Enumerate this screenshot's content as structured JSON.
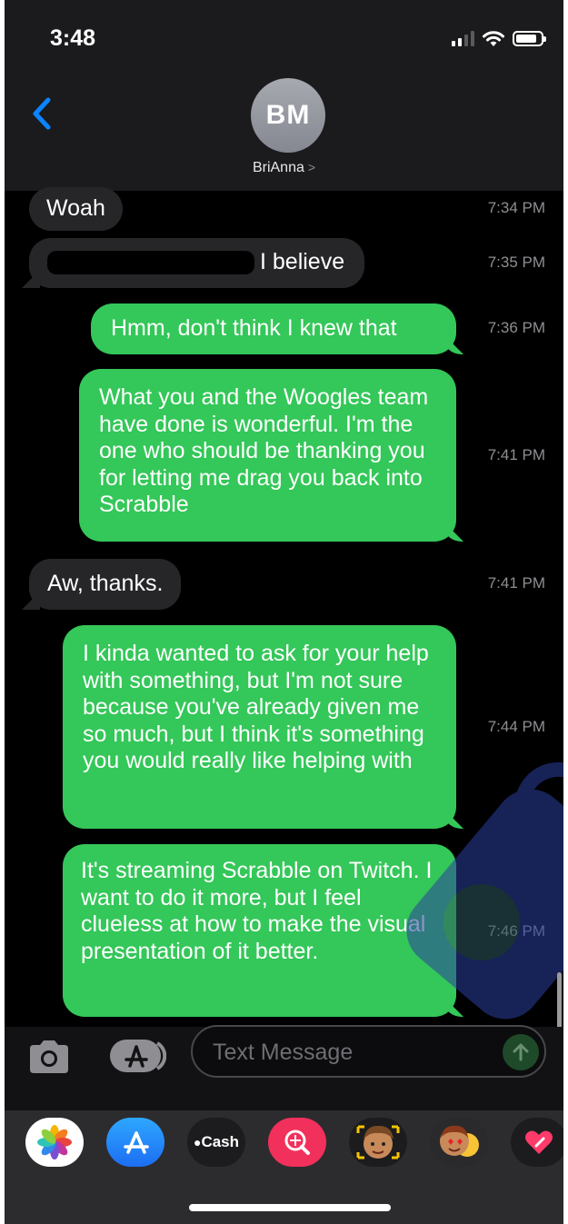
{
  "status_bar": {
    "time": "3:48"
  },
  "header": {
    "avatar_initials": "BM",
    "contact_name": "BriAnna",
    "contact_chevron": ">"
  },
  "messages": [
    {
      "direction": "incoming",
      "text": "Woah",
      "time": "7:34 PM"
    },
    {
      "direction": "incoming",
      "text": "I believe",
      "time": "7:35 PM",
      "redacted_prefix": true
    },
    {
      "direction": "outgoing",
      "text": "Hmm, don't think I knew that",
      "time": "7:36 PM"
    },
    {
      "direction": "outgoing",
      "text": "What you and the Woogles team have done is wonderful. I'm the one who should be thanking you for letting me drag you back into Scrabble",
      "time": "7:41 PM"
    },
    {
      "direction": "incoming",
      "text": "Aw, thanks.",
      "time": "7:41 PM"
    },
    {
      "direction": "outgoing",
      "text": "I kinda wanted to ask for your help with something, but I'm not sure because you've already given me so much, but I think it's something you would really like helping with",
      "time": "7:44 PM"
    },
    {
      "direction": "outgoing",
      "text": "It's streaming Scrabble on Twitch. I want to do it more, but I feel clueless at how to make the visual presentation of it better.",
      "time": "7:46 PM"
    }
  ],
  "composer": {
    "placeholder": "Text Message",
    "camera_icon": "camera-icon",
    "apps_icon": "app-store-icon",
    "send_icon": "arrow-up-icon"
  },
  "app_drawer": {
    "apps": [
      {
        "name": "photos-app-icon"
      },
      {
        "name": "app-store-app-icon"
      },
      {
        "name": "apple-cash-app-icon",
        "label": "Cash"
      },
      {
        "name": "web-search-app-icon"
      },
      {
        "name": "memoji-stickers-app-icon"
      },
      {
        "name": "animoji-app-icon"
      },
      {
        "name": "digital-touch-app-icon"
      }
    ]
  },
  "colors": {
    "outgoing_bubble": "#34c759",
    "incoming_bubble": "#262629",
    "accent": "#0a84ff"
  }
}
